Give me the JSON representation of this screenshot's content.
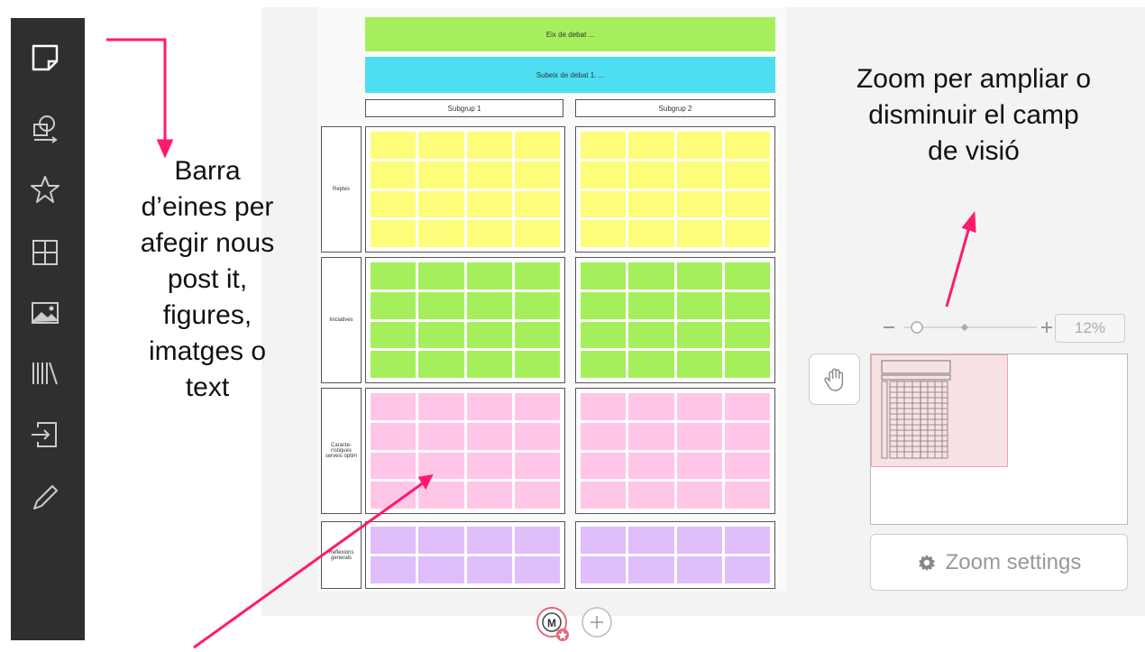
{
  "toolbar": {
    "tools": [
      {
        "name": "sticky-note-icon"
      },
      {
        "name": "shapes-icon"
      },
      {
        "name": "star-icon"
      },
      {
        "name": "grid-icon"
      },
      {
        "name": "image-icon"
      },
      {
        "name": "library-icon"
      },
      {
        "name": "import-icon"
      },
      {
        "name": "pencil-icon"
      }
    ]
  },
  "board": {
    "banner1": "Eix de debat ...",
    "banner2": "Subeix de debat 1. ...",
    "subgroup1": "Subgrup 1",
    "subgroup2": "Subgrup 2",
    "rows": [
      {
        "label": "Reptes",
        "color": "#fdfd7a"
      },
      {
        "label": "Iniciatives",
        "color": "#a6ef5c"
      },
      {
        "label": "Caracte-rístiques serveis òptim",
        "color": "#ffc6e8"
      },
      {
        "label": "Reflexions generals",
        "color": "#e0bdfb"
      }
    ]
  },
  "annotations": {
    "left": [
      "Barra",
      "d’eines per",
      "afegir nous",
      "post it,",
      "figures,",
      "imatges o",
      "text"
    ],
    "right": [
      "Zoom per ampliar o",
      "disminuir el camp",
      "de visió"
    ],
    "arrow_color": "#ff1a6e"
  },
  "zoom": {
    "percent": "12%",
    "settings_label": "Zoom settings",
    "level_percent": 12
  }
}
